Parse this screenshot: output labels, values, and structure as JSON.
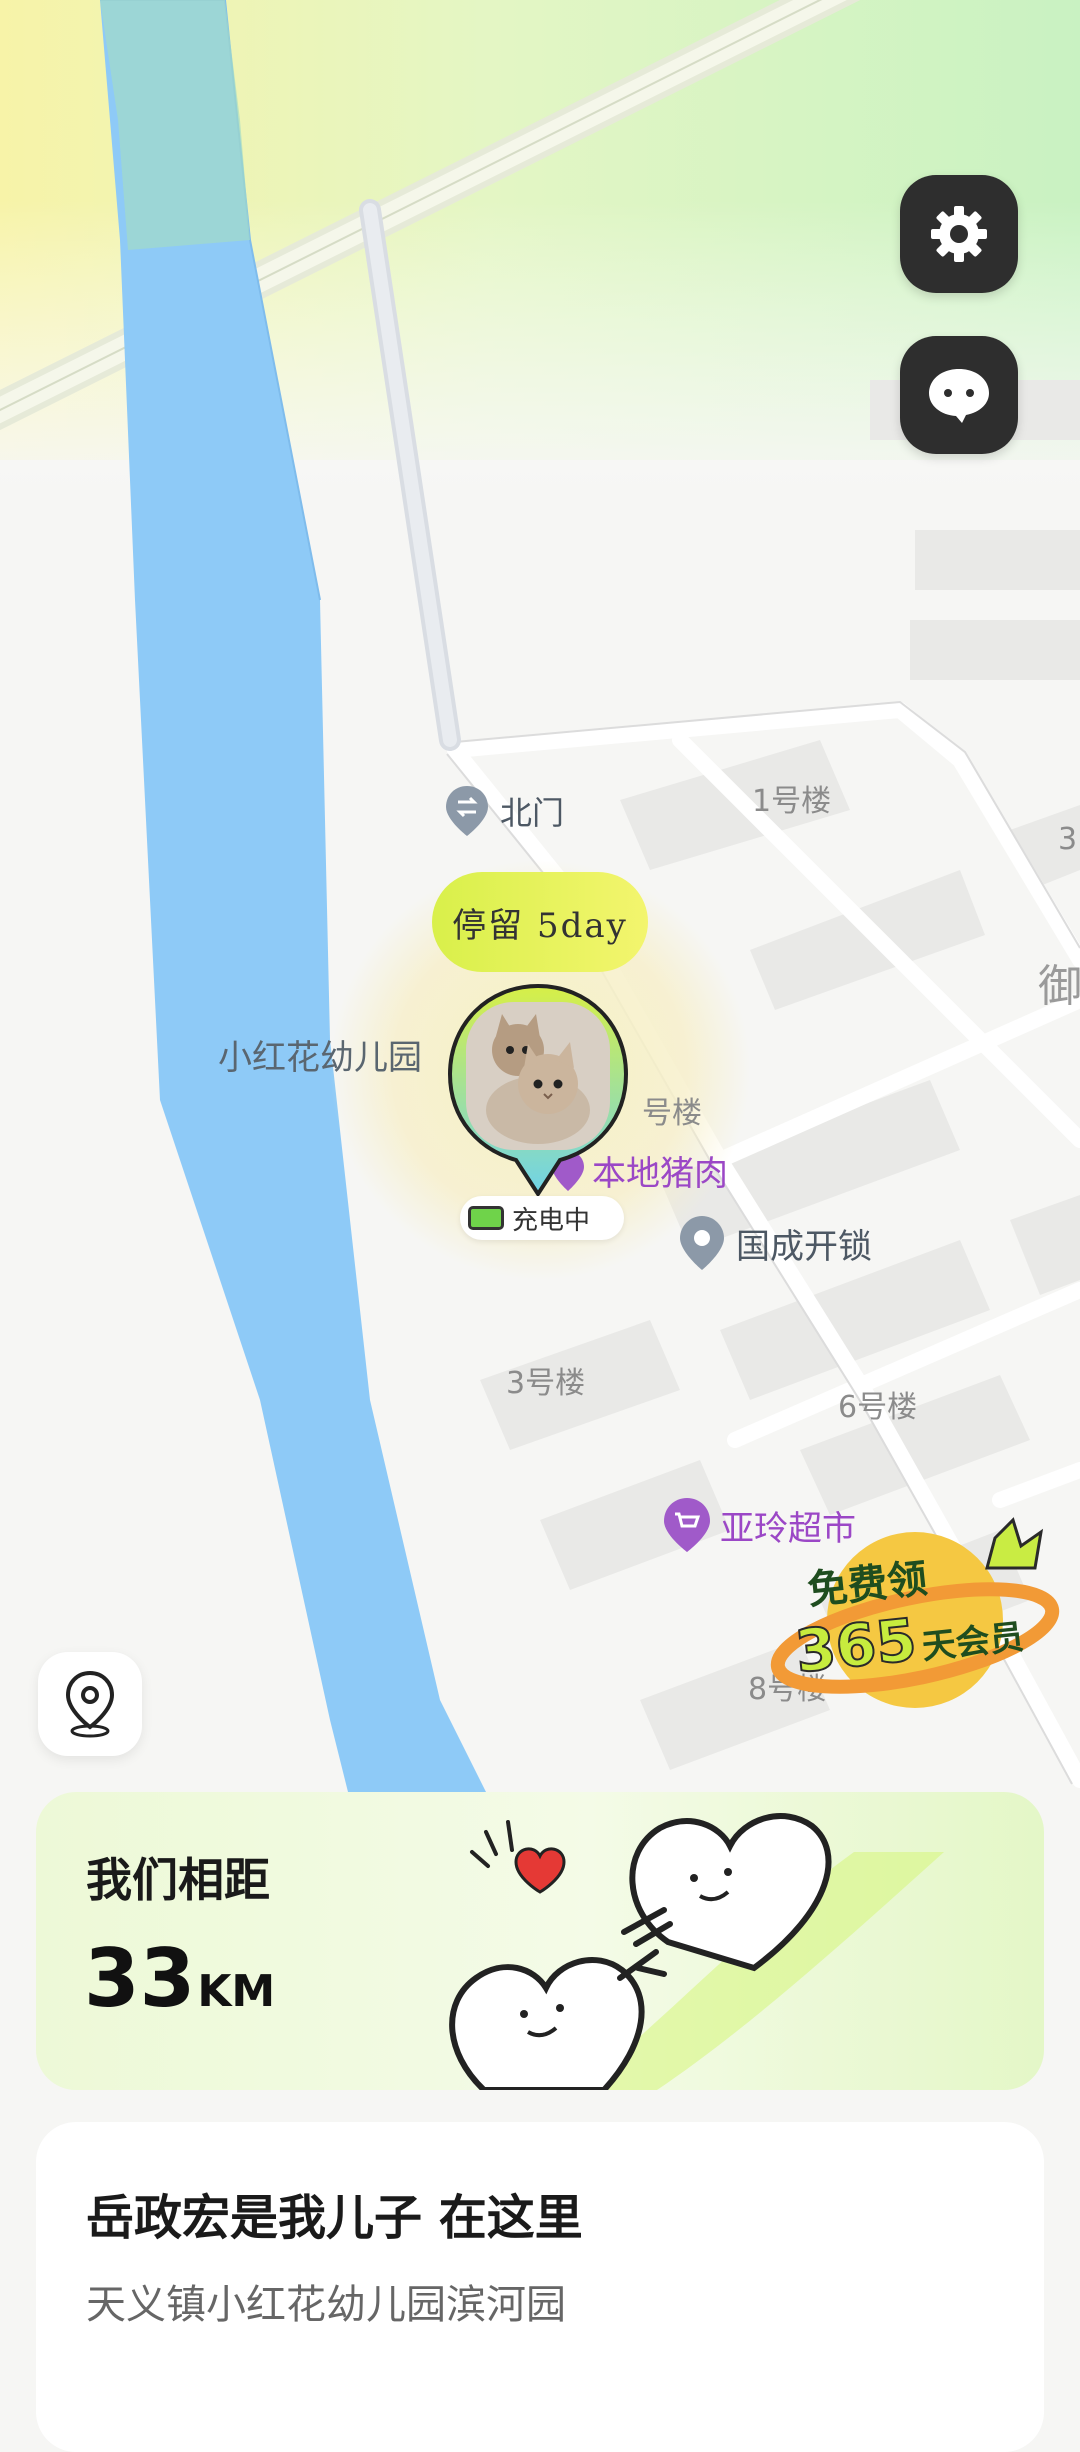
{
  "map": {
    "pois": {
      "north_gate": "北门",
      "kindergarten": "小红花幼儿园",
      "pork_shop": "本地猪肉",
      "locksmith": "国成开锁",
      "supermarket": "亚玲超市",
      "edge_char": "御"
    },
    "buildings": {
      "b1": "1号楼",
      "b3": "3号楼",
      "b6": "6号楼",
      "b8": "8号楼",
      "b_partial": "号楼",
      "b_edge": "3"
    }
  },
  "marker": {
    "stay_label": "停留 5day",
    "charging_label": "充电中",
    "avatar_icon": "cat-avatar-icon"
  },
  "buttons": {
    "settings_icon": "gear-icon",
    "chat_icon": "chat-bubble-icon",
    "locate_icon": "location-pin-icon"
  },
  "promo": {
    "line1": "免费领",
    "line2_num": "365",
    "line2_text": "天会员"
  },
  "distance_card": {
    "title": "我们相距",
    "value": "33",
    "unit": "KM"
  },
  "address_card": {
    "title": "岳政宏是我儿子 在这里",
    "address": "天义镇小红花幼儿园滨河园"
  },
  "colors": {
    "river": "#8ecaf7",
    "accent_green": "#d9f04a",
    "dark_button": "#2e2e2e"
  }
}
